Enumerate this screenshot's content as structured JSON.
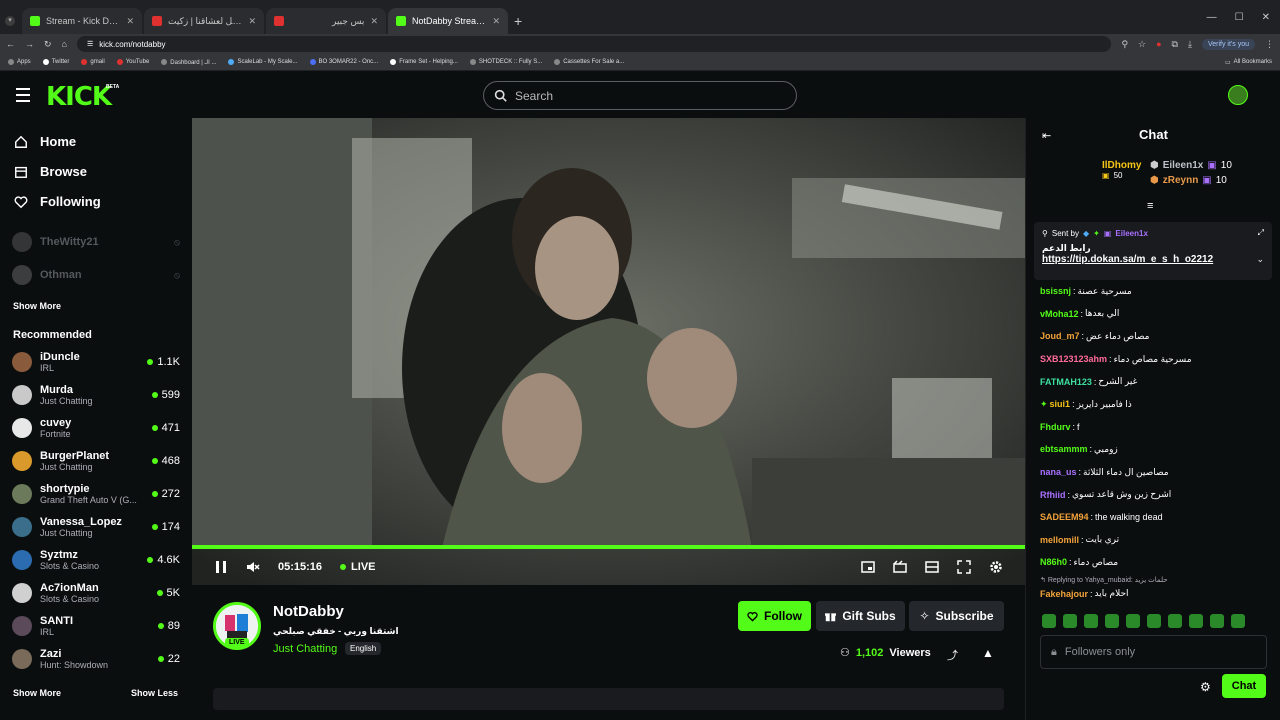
{
  "browser": {
    "tabs": [
      {
        "label": "Stream - Kick Dashboard",
        "color": "#53fc18"
      },
      {
        "label": "مهرجان هتعمل لعشاقنا | زكيت",
        "color": "#e03131"
      },
      {
        "label": "بس جبير",
        "color": "#e03131"
      },
      {
        "label": "NotDabby Stream - Watch Live",
        "color": "#53fc18"
      }
    ],
    "new_tab": "+",
    "url": "kick.com/notdabby",
    "verify": "Verify it's you",
    "bookmarks": [
      "Apps",
      "Twitter",
      "gmail",
      "YouTube",
      "Dashboard | الـ ...",
      "ScaleLab - My Scale...",
      "BO 3OMAR22 - Onc...",
      "Frame Set - Helping...",
      "SHOTDECK :: Fully S...",
      "Cassettes For Sale a..."
    ],
    "all_bookmarks": "All Bookmarks"
  },
  "header": {
    "logo": "KICK",
    "beta": "BETA",
    "search_placeholder": "Search"
  },
  "sidebar": {
    "nav": [
      {
        "label": "Home",
        "icon": "home-icon"
      },
      {
        "label": "Browse",
        "icon": "browse-icon"
      },
      {
        "label": "Following",
        "icon": "heart-icon"
      }
    ],
    "following": [
      {
        "name": "TheWitty21"
      },
      {
        "name": "Othman"
      }
    ],
    "show_more": "Show More",
    "recommended_title": "Recommended",
    "recommended": [
      {
        "name": "iDuncle",
        "category": "IRL",
        "viewers": "1.1K",
        "color": "#8a5a3c"
      },
      {
        "name": "Murda",
        "category": "Just Chatting",
        "viewers": "599",
        "color": "#c9c9c9"
      },
      {
        "name": "cuvey",
        "category": "Fortnite",
        "viewers": "471",
        "color": "#e8e8e8"
      },
      {
        "name": "BurgerPlanet",
        "category": "Just Chatting",
        "viewers": "468",
        "color": "#d99a2b"
      },
      {
        "name": "shortypie",
        "category": "Grand Theft Auto V (G...",
        "viewers": "272",
        "color": "#6b7a5a"
      },
      {
        "name": "Vanessa_Lopez",
        "category": "Just Chatting",
        "viewers": "174",
        "color": "#3a6e8a"
      },
      {
        "name": "Syztmz",
        "category": "Slots & Casino",
        "viewers": "4.6K",
        "color": "#2b6cb0"
      },
      {
        "name": "Ac7ionMan",
        "category": "Slots & Casino",
        "viewers": "5K",
        "color": "#d0d0d0"
      },
      {
        "name": "SANTI",
        "category": "IRL",
        "viewers": "89",
        "color": "#5a4a5a"
      },
      {
        "name": "Zazi",
        "category": "Hunt: Showdown",
        "viewers": "22",
        "color": "#7a6a5a"
      }
    ],
    "show_more_bottom": "Show More",
    "show_less": "Show Less"
  },
  "player": {
    "time": "05:15:16",
    "live": "LIVE",
    "progress": 1.0
  },
  "channel": {
    "name": "NotDabby",
    "title": "اشتقنا وربي - خفقي صبلحي",
    "category": "Just Chatting",
    "language": "English",
    "avatar_live": "LIVE",
    "follow": "Follow",
    "gift": "Gift Subs",
    "subscribe": "Subscribe",
    "viewers": "1,102",
    "viewers_label": "Viewers"
  },
  "chat": {
    "title": "Chat",
    "leaderboard": {
      "rank": "1",
      "top": {
        "name": "IlDhomy",
        "count": "50"
      },
      "second": {
        "name": "Eileen1x",
        "count": "10"
      },
      "third": {
        "name": "zReynn",
        "count": "10"
      }
    },
    "pinned": {
      "sent_by": "Sent by",
      "user": "Eileen1x",
      "text": "رابط الدعم",
      "link": "https://tip.dokan.sa/m_e_s_h_o2212"
    },
    "messages": [
      {
        "user": "bsissnj",
        "text": "مسرحية عصنة",
        "color": "#53fc18"
      },
      {
        "user": "vMoha12",
        "text": "الي بعدها",
        "color": "#53fc18"
      },
      {
        "user": "Joud_m7",
        "text": "مصاص دماء عض",
        "color": "#f2a33a"
      },
      {
        "user": "SXB123123ahm",
        "text": "مسرحية مصاص دماء",
        "color": "#ff6b9a"
      },
      {
        "user": "FATMAH123",
        "text": "غير الشرح",
        "color": "#3ee0a0"
      },
      {
        "user": "siui1",
        "text": "ذا فامبير دايريز",
        "color": "#f5c518"
      },
      {
        "user": "Fhdurv",
        "text": "f",
        "color": "#53fc18"
      },
      {
        "user": "ebtsammm",
        "text": "زومبي",
        "color": "#53fc18"
      },
      {
        "user": "nana_us",
        "text": "مصاصين ال دماء الثلاثة",
        "color": "#a970ff"
      },
      {
        "user": "Rfhiid",
        "text": "اشرح زين وش قاعد تسوي",
        "color": "#a970ff"
      },
      {
        "user": "SADEEM94",
        "text": "the walking dead",
        "color": "#f2a33a"
      },
      {
        "user": "mellomill",
        "text": "تري بايت",
        "color": "#f2a33a"
      },
      {
        "user": "N86h0",
        "text": "مصاص دماء",
        "color": "#53fc18"
      }
    ],
    "reply_note": "Replying to Yahya_mubaid: حلمات يزيد",
    "reply_user": "Fakehajour",
    "reply_text": "احلام بايد",
    "input_placeholder": "Followers only",
    "send": "Chat"
  }
}
